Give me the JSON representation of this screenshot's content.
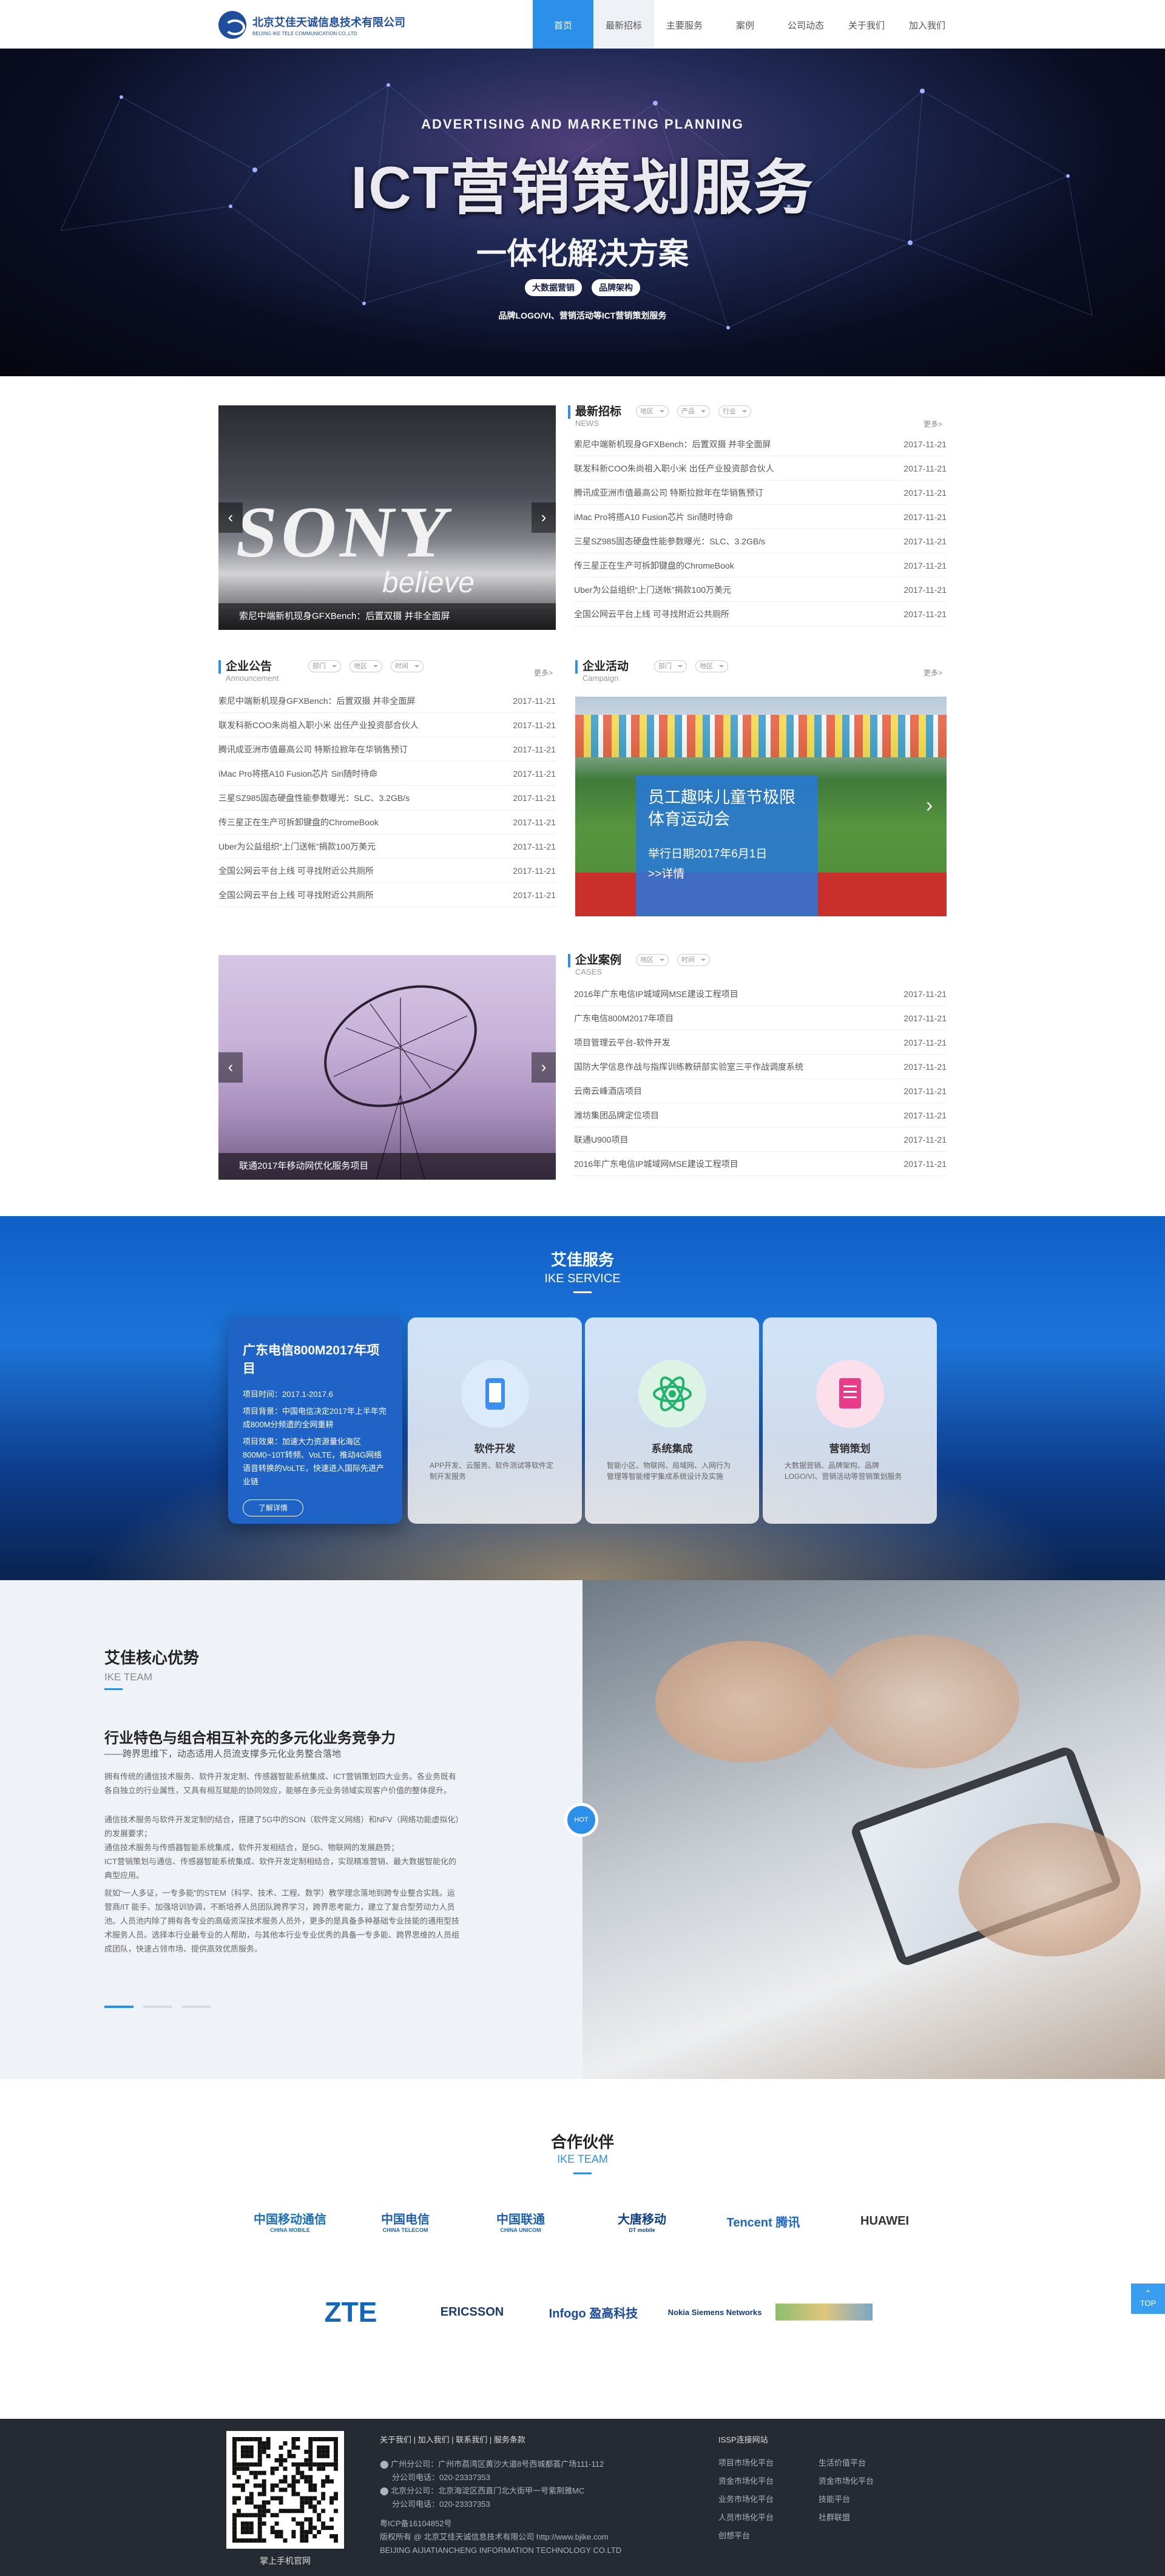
{
  "header": {
    "logo_cn": "北京艾佳天诚信息技术有限公司",
    "logo_en": "BEIJING IKE TELE COMMUNICATION CO.,LTD",
    "nav": [
      "首页",
      "最新招标",
      "主要服务",
      "案例",
      "公司动态",
      "关于我们",
      "加入我们"
    ]
  },
  "hero": {
    "subtitle": "ADVERTISING AND MARKETING PLANNING",
    "title": "ICT营销策划服务",
    "solution": "一体化解决方案",
    "tags": [
      "大数据营销",
      "品牌架构"
    ],
    "footnote": "品牌LOGO/VI、营销活动等ICT营销策划服务"
  },
  "slider1": {
    "caption": "索尼中端新机现身GFXBench：后置双摄 并非全面屏"
  },
  "bidding": {
    "title": "最新招标",
    "en": "NEWS",
    "filters": [
      "地区",
      "产品",
      "行业"
    ],
    "more": "更多>",
    "items": [
      {
        "title": "索尼中端新机现身GFXBench：后置双摄 并非全面屏",
        "date": "2017-11-21"
      },
      {
        "title": "联发科新COO朱尚祖入职小米 出任产业投资部合伙人",
        "date": "2017-11-21"
      },
      {
        "title": "腾讯成亚洲市值最高公司 特斯拉掀年在华销售预订",
        "date": "2017-11-21"
      },
      {
        "title": "iMac Pro将搭A10 Fusion芯片 Siri随时待命",
        "date": "2017-11-21"
      },
      {
        "title": "三星SZ985固态硬盘性能参数曝光：SLC、3.2GB/s",
        "date": "2017-11-21"
      },
      {
        "title": "传三星正在生产可拆卸键盘的ChromeBook",
        "date": "2017-11-21"
      },
      {
        "title": "Uber为公益组织“上门送帐”捐款100万美元",
        "date": "2017-11-21"
      },
      {
        "title": "全国公网云平台上线 可寻找附近公共厕所",
        "date": "2017-11-21"
      }
    ]
  },
  "announce": {
    "title": "企业公告",
    "en": "Announcement",
    "filters": [
      "部门",
      "地区",
      "时间"
    ],
    "more": "更多>",
    "items": [
      {
        "title": "索尼中端新机现身GFXBench：后置双摄 并非全面屏",
        "date": "2017-11-21"
      },
      {
        "title": "联发科新COO朱尚祖入职小米 出任产业投资部合伙人",
        "date": "2017-11-21"
      },
      {
        "title": "腾讯成亚洲市值最高公司 特斯拉掀年在华销售预订",
        "date": "2017-11-21"
      },
      {
        "title": "iMac Pro将搭A10 Fusion芯片 Siri随时待命",
        "date": "2017-11-21"
      },
      {
        "title": "三星SZ985固态硬盘性能参数曝光：SLC、3.2GB/s",
        "date": "2017-11-21"
      },
      {
        "title": "传三星正在生产可拆卸键盘的ChromeBook",
        "date": "2017-11-21"
      },
      {
        "title": "Uber为公益组织“上门送帐”捐款100万美元",
        "date": "2017-11-21"
      },
      {
        "title": "全国公网云平台上线 可寻找附近公共厕所",
        "date": "2017-11-21"
      },
      {
        "title": "全国公网云平台上线 可寻找附近公共厕所",
        "date": "2017-11-21"
      }
    ]
  },
  "campaign": {
    "title": "企业活动",
    "en": "Campaign",
    "filters": [
      "部门",
      "地区"
    ],
    "more": "更多>",
    "event_title": "员工趣味儿童节极限体育运动会",
    "event_date": "举行日期2017年6月1日",
    "event_link": ">>详情"
  },
  "slider2": {
    "caption": "联通2017年移动网优化服务项目"
  },
  "cases": {
    "title": "企业案例",
    "en": "CASES",
    "filters": [
      "地区",
      "时间"
    ],
    "more": "更多>",
    "items": [
      {
        "title": "2016年广东电信IP城域网MSE建设工程项目",
        "date": "2017-11-21"
      },
      {
        "title": "广东电信800M2017年项目",
        "date": "2017-11-21"
      },
      {
        "title": "项目管理云平台-软件开发",
        "date": "2017-11-21"
      },
      {
        "title": "国防大学信息作战与指挥训练教研部实验室三平作战调度系统",
        "date": "2017-11-21"
      },
      {
        "title": "云南云峰酒店项目",
        "date": "2017-11-21"
      },
      {
        "title": "潍坊集团品牌定位项目",
        "date": "2017-11-21"
      },
      {
        "title": "联通U900项目",
        "date": "2017-11-21"
      },
      {
        "title": "2016年广东电信IP城域网MSE建设工程项目",
        "date": "2017-11-21"
      }
    ]
  },
  "services": {
    "title": "艾佳服务",
    "en": "IKE SERVICE",
    "featured": {
      "title": "广东电信800M2017年项目",
      "time": "项目时间：2017.1-2017.6",
      "background": "项目背景：中国电信决定2017年上半年完成800M分频遗的全网重耕",
      "result": "项目效果：加速大力资源量化海区800M0~10T转频、VoLTE，推动4G网络语音转换的VoLTE，快速进入国际先进产业链",
      "button": "了解详情"
    },
    "cards": [
      {
        "title": "软件开发",
        "desc": "APP开发、云服务、软件测试等软件定制开发服务",
        "icon": "phone-icon",
        "color": "#3a8ff0"
      },
      {
        "title": "系统集成",
        "desc": "智能小区、物联网、局域网、入网行为管理等智能楼宇集成系统设计及实施",
        "icon": "atom-icon",
        "color": "#23b26b"
      },
      {
        "title": "营销策划",
        "desc": "大数据营销、品牌架构、品牌LOGO/VI、营销活动等营销策划服务",
        "icon": "document-icon",
        "color": "#e83c8a"
      }
    ]
  },
  "core": {
    "title": "艾佳核心优势",
    "en": "IKE TEAM",
    "heading": "行业特色与组合相互补充的多元化业务竞争力",
    "subheading": "——跨界思维下，动态适用人员流支撑多元化业务整合落地",
    "p1": "拥有传统的通信技术服务、软件开发定制、传感器智能系统集成、ICT营销策划四大业务。各业务既有各自独立的行业属性，又具有相互赋能的协同效应，能够在多元业务领域实现客户价值的整体提升。",
    "p2": "通信技术服务与软件开发定制的结合，搭建了5G中的SON（软件定义网络）和NFV（网络功能虚拟化）的发展要求；",
    "p3": "通信技术服务与传感器智能系统集成，软件开发相结合，是5G、物联网的发展趋势；",
    "p4": "ICT营销策划与通信、传感器智能系统集成、软件开发定制相结合，实现精准营销、最大数据智能化的典型应用。",
    "p5": "就如“一人多证，一专多能”的STEM（科学、技术、工程、数学）教学理念落地到跨专业整合实践。运营商/IT 能手、加强培训协调，不断培养人员团队跨界学习，跨界思考能力，建立了复合型劳动力人员池。人员池内除了拥有各专业的高级资深技术服务人员外，更多的是具备多种基础专业技能的通用型技术服务人员。选择本行业最专业的人帮助，与其他本行业专业优秀的具备一专多能、跨界思维的人员组成团队，快速占领市场、提供高效优质服务。",
    "badge": "HOT"
  },
  "partners": {
    "title": "合作伙伴",
    "en": "IKE TEAM",
    "logos": [
      {
        "name": "中国移动通信",
        "sub": "CHINA MOBILE",
        "color": "#1a6fb8"
      },
      {
        "name": "中国电信",
        "sub": "CHINA TELECOM",
        "color": "#1f5fb5"
      },
      {
        "name": "中国联通",
        "sub": "CHINA UNICOM",
        "color": "#1d61b0"
      },
      {
        "name": "大唐移动",
        "sub": "DT mobile",
        "color": "#0f3f86"
      },
      {
        "name": "Tencent 腾讯",
        "sub": "",
        "color": "#1b66c7"
      },
      {
        "name": "HUAWEI",
        "sub": "",
        "color": "#333333"
      },
      {
        "name": "ZTE",
        "sub": "",
        "color": "#1566b6"
      },
      {
        "name": "ERICSSON",
        "sub": "",
        "color": "#1f3a6e"
      },
      {
        "name": "Infogo 盈高科技",
        "sub": "",
        "color": "#1b4a9c"
      },
      {
        "name": "Nokia Siemens Networks",
        "sub": "",
        "color": "#123b7a"
      },
      {
        "name": "",
        "sub": "",
        "color": "#7fa86a"
      }
    ],
    "top_button": "TOP"
  },
  "footer": {
    "qr_caption": "掌上手机官网",
    "links": [
      "关于我们",
      "加入我们",
      "联系我们",
      "服务条款"
    ],
    "guangzhou": "广州分公司：广州市荔湾区黄沙大道8号西城都荟广场111-112",
    "guangzhou_tel": "分公司电话：020-23337353",
    "beijing": "北京分公司：北京海淀区西直门北大街甲一号紫荆雅MC",
    "beijing_tel": "分公司电话：020-23337353",
    "icp": "粤ICP备16104852号",
    "copyright": "版权所有 @ 北京艾佳天诚信息技术有限公司 http://www.bjike.com",
    "company_en": "BEIJING AIJIATIANCHENG INFORMATION TECHNOLOGY CO.LTD",
    "issp_title": "ISSP连接网站",
    "issp_links": [
      "项目市场化平台",
      "生活价值平台",
      "资金市场化平台",
      "资金市场化平台",
      "业务市场化平台",
      "技能平台",
      "人员市场化平台",
      "社群联盟",
      "创想平台"
    ]
  }
}
